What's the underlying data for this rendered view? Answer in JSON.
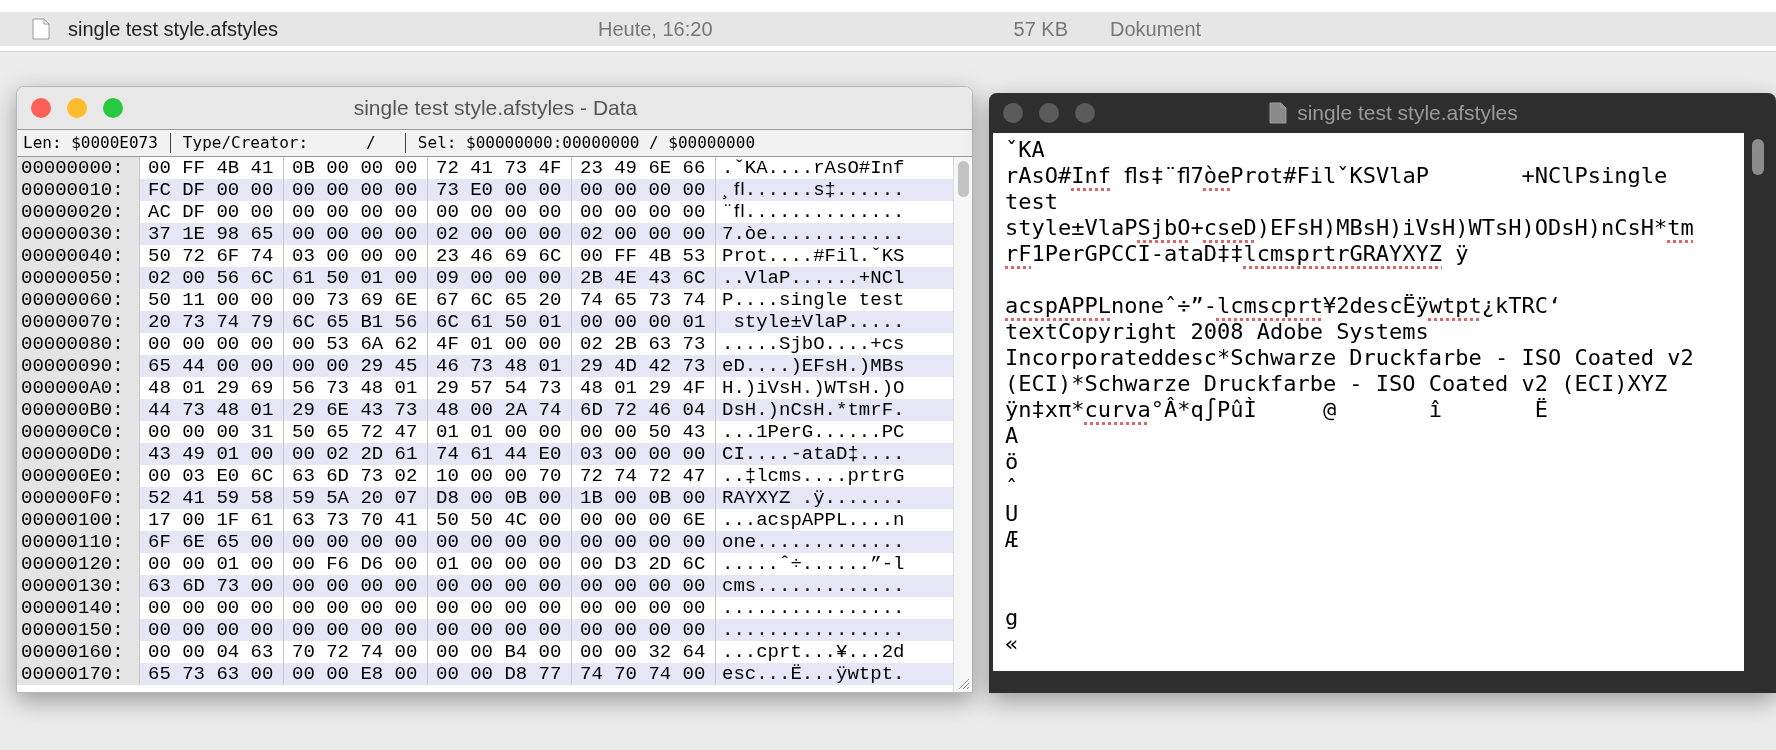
{
  "finder_row": {
    "name": "single test style.afstyles",
    "date": "Heute, 16:20",
    "size": "57 KB",
    "kind": "Dokument"
  },
  "hex_window": {
    "title": "single test style.afstyles - Data",
    "info": [
      "Len: $0000E073",
      "Type/Creator:      /",
      "Sel: $00000000:00000000 / $00000000"
    ],
    "rows": [
      {
        "address": "00000000:",
        "bytes": [
          "00 FF 4B 41",
          "0B 00 00 00",
          "72 41 73 4F",
          "23 49 6E 66"
        ],
        "ascii": ".ˇKA....rAsO#Inf"
      },
      {
        "address": "00000010:",
        "bytes": [
          "FC DF 00 00",
          "00 00 00 00",
          "73 E0 00 00",
          "00 00 00 00"
        ],
        "ascii": "¸ﬂ......s‡......"
      },
      {
        "address": "00000020:",
        "bytes": [
          "AC DF 00 00",
          "00 00 00 00",
          "00 00 00 00",
          "00 00 00 00"
        ],
        "ascii": "¨ﬂ.............."
      },
      {
        "address": "00000030:",
        "bytes": [
          "37 1E 98 65",
          "00 00 00 00",
          "02 00 00 00",
          "02 00 00 00"
        ],
        "ascii": "7.òe............"
      },
      {
        "address": "00000040:",
        "bytes": [
          "50 72 6F 74",
          "03 00 00 00",
          "23 46 69 6C",
          "00 FF 4B 53"
        ],
        "ascii": "Prot....#Fil.ˇKS"
      },
      {
        "address": "00000050:",
        "bytes": [
          "02 00 56 6C",
          "61 50 01 00",
          "09 00 00 00",
          "2B 4E 43 6C"
        ],
        "ascii": "..VlaP......+NCl"
      },
      {
        "address": "00000060:",
        "bytes": [
          "50 11 00 00",
          "00 73 69 6E",
          "67 6C 65 20",
          "74 65 73 74"
        ],
        "ascii": "P....single test"
      },
      {
        "address": "00000070:",
        "bytes": [
          "20 73 74 79",
          "6C 65 B1 56",
          "6C 61 50 01",
          "00 00 00 01"
        ],
        "ascii": " style±VlaP....."
      },
      {
        "address": "00000080:",
        "bytes": [
          "00 00 00 00",
          "00 53 6A 62",
          "4F 01 00 00",
          "02 2B 63 73"
        ],
        "ascii": ".....SjbO....+cs"
      },
      {
        "address": "00000090:",
        "bytes": [
          "65 44 00 00",
          "00 00 29 45",
          "46 73 48 01",
          "29 4D 42 73"
        ],
        "ascii": "eD....)EFsH.)MBs"
      },
      {
        "address": "000000A0:",
        "bytes": [
          "48 01 29 69",
          "56 73 48 01",
          "29 57 54 73",
          "48 01 29 4F"
        ],
        "ascii": "H.)iVsH.)WTsH.)O"
      },
      {
        "address": "000000B0:",
        "bytes": [
          "44 73 48 01",
          "29 6E 43 73",
          "48 00 2A 74",
          "6D 72 46 04"
        ],
        "ascii": "DsH.)nCsH.*tmrF."
      },
      {
        "address": "000000C0:",
        "bytes": [
          "00 00 00 31",
          "50 65 72 47",
          "01 01 00 00",
          "00 00 50 43"
        ],
        "ascii": "...1PerG......PC"
      },
      {
        "address": "000000D0:",
        "bytes": [
          "43 49 01 00",
          "00 02 2D 61",
          "74 61 44 E0",
          "03 00 00 00"
        ],
        "ascii": "CI....-ataD‡...."
      },
      {
        "address": "000000E0:",
        "bytes": [
          "00 03 E0 6C",
          "63 6D 73 02",
          "10 00 00 70",
          "72 74 72 47"
        ],
        "ascii": "..‡lcms....prtrG"
      },
      {
        "address": "000000F0:",
        "bytes": [
          "52 41 59 58",
          "59 5A 20 07",
          "D8 00 0B 00",
          "1B 00 0B 00"
        ],
        "ascii": "RAYXYZ .ÿ......."
      },
      {
        "address": "00000100:",
        "bytes": [
          "17 00 1F 61",
          "63 73 70 41",
          "50 50 4C 00",
          "00 00 00 6E"
        ],
        "ascii": "...acspAPPL....n"
      },
      {
        "address": "00000110:",
        "bytes": [
          "6F 6E 65 00",
          "00 00 00 00",
          "00 00 00 00",
          "00 00 00 00"
        ],
        "ascii": "one............."
      },
      {
        "address": "00000120:",
        "bytes": [
          "00 00 01 00",
          "00 F6 D6 00",
          "01 00 00 00",
          "00 D3 2D 6C"
        ],
        "ascii": ".....ˆ÷......”-l"
      },
      {
        "address": "00000130:",
        "bytes": [
          "63 6D 73 00",
          "00 00 00 00",
          "00 00 00 00",
          "00 00 00 00"
        ],
        "ascii": "cms............."
      },
      {
        "address": "00000140:",
        "bytes": [
          "00 00 00 00",
          "00 00 00 00",
          "00 00 00 00",
          "00 00 00 00"
        ],
        "ascii": "................"
      },
      {
        "address": "00000150:",
        "bytes": [
          "00 00 00 00",
          "00 00 00 00",
          "00 00 00 00",
          "00 00 00 00"
        ],
        "ascii": "................"
      },
      {
        "address": "00000160:",
        "bytes": [
          "00 00 04 63",
          "70 72 74 00",
          "00 00 B4 00",
          "00 00 32 64"
        ],
        "ascii": "...cprt...¥...2d"
      },
      {
        "address": "00000170:",
        "bytes": [
          "65 73 63 00",
          "00 00 E8 00",
          "00 00 D8 77",
          "74 70 74 00"
        ],
        "ascii": "esc...Ë...ÿwtpt."
      }
    ]
  },
  "text_window": {
    "title": "single test style.afstyles",
    "lines": [
      {
        "kind": "text",
        "segments": [
          {
            "text": "ˇKA",
            "flagged": false
          }
        ]
      },
      {
        "kind": "text",
        "segments": [
          {
            "text": "rAsO#",
            "flagged": false
          },
          {
            "text": "Inf",
            "flagged": true
          },
          {
            "text": " ﬂs‡¨ﬂ7",
            "flagged": false
          },
          {
            "text": "òe",
            "flagged": true
          },
          {
            "text": "Prot#FilˇKSVlaP       +NClPsingle",
            "flagged": false
          }
        ]
      },
      {
        "kind": "text",
        "segments": [
          {
            "text": "test",
            "flagged": false
          }
        ]
      },
      {
        "kind": "text",
        "segments": [
          {
            "text": "style±VlaP",
            "flagged": false
          },
          {
            "text": "SjbO",
            "flagged": true
          },
          {
            "text": "+",
            "flagged": false
          },
          {
            "text": "cseD",
            "flagged": true
          },
          {
            "text": ")EFsH)MBsH)iVsH)WTsH)ODsH)nCsH*",
            "flagged": false
          },
          {
            "text": "tm",
            "flagged": true
          }
        ]
      },
      {
        "kind": "text",
        "segments": [
          {
            "text": "rF",
            "flagged": true
          },
          {
            "text": "1PerGPCCI-ataD‡‡",
            "flagged": false
          },
          {
            "text": "lcmsprtrGRAYXYZ",
            "flagged": true
          },
          {
            "text": " ÿ",
            "flagged": false
          }
        ]
      },
      {
        "kind": "blank"
      },
      {
        "kind": "text",
        "segments": [
          {
            "text": "acspAPPL",
            "flagged": true
          },
          {
            "text": "noneˆ÷”-",
            "flagged": false
          },
          {
            "text": "lcmscprt",
            "flagged": true
          },
          {
            "text": "¥2descËÿ",
            "flagged": false
          },
          {
            "text": "wtpt",
            "flagged": true
          },
          {
            "text": "¿kTRC‘",
            "flagged": false
          }
        ]
      },
      {
        "kind": "text",
        "segments": [
          {
            "text": "textCopyright 2008 Adobe Systems",
            "flagged": false
          }
        ]
      },
      {
        "kind": "text",
        "segments": [
          {
            "text": "Incorporateddesc*Schwarze Druckfarbe - ISO Coated v2",
            "flagged": false
          }
        ]
      },
      {
        "kind": "text",
        "segments": [
          {
            "text": "(ECI)*Schwarze Druckfarbe - ISO Coated v2 (ECI)XYZ",
            "flagged": false
          }
        ]
      },
      {
        "kind": "text",
        "segments": [
          {
            "text": "ÿn‡xπ*",
            "flagged": false
          },
          {
            "text": "curva",
            "flagged": true
          },
          {
            "text": "°Â*q∫PûÌ     @       î       Ë",
            "flagged": false
          }
        ]
      },
      {
        "kind": "text",
        "segments": [
          {
            "text": "A",
            "flagged": false
          }
        ]
      },
      {
        "kind": "text",
        "segments": [
          {
            "text": "ö",
            "flagged": false
          }
        ]
      },
      {
        "kind": "text",
        "segments": [
          {
            "text": "ˆ",
            "flagged": false
          }
        ]
      },
      {
        "kind": "text",
        "segments": [
          {
            "text": "U",
            "flagged": false
          }
        ]
      },
      {
        "kind": "text",
        "segments": [
          {
            "text": "Æ",
            "flagged": false
          }
        ]
      },
      {
        "kind": "blank"
      },
      {
        "kind": "blank"
      },
      {
        "kind": "text",
        "segments": [
          {
            "text": "g",
            "flagged": false
          }
        ]
      },
      {
        "kind": "text",
        "segments": [
          {
            "text": "«",
            "flagged": false
          }
        ]
      }
    ]
  }
}
